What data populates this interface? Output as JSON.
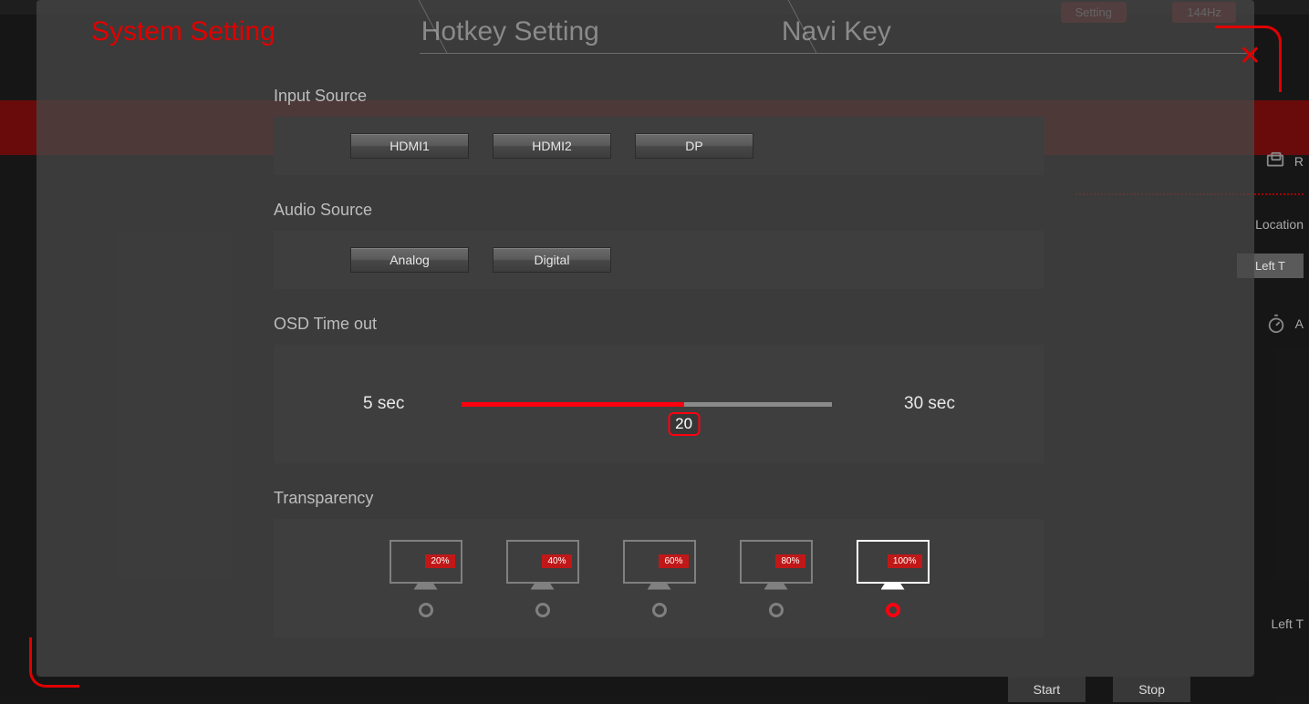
{
  "background": {
    "setting_pill": "Setting",
    "hz_pill": "144Hz",
    "r_label": "R",
    "location_label": "Location",
    "left_top_btn": "Left T",
    "a_label": "A",
    "left_t_label": "Left T",
    "start_btn": "Start",
    "stop_btn": "Stop"
  },
  "tabs": {
    "system": "System Setting",
    "hotkey": "Hotkey Setting",
    "navi": "Navi Key"
  },
  "input_source": {
    "label": "Input Source",
    "options": [
      "HDMI1",
      "HDMI2",
      "DP"
    ]
  },
  "audio_source": {
    "label": "Audio Source",
    "options": [
      "Analog",
      "Digital"
    ]
  },
  "osd": {
    "label": "OSD Time out",
    "min_label": "5 sec",
    "max_label": "30 sec",
    "min": 5,
    "max": 30,
    "value": 20,
    "value_label": "20"
  },
  "transparency": {
    "label": "Transparency",
    "options": [
      "20%",
      "40%",
      "60%",
      "80%",
      "100%"
    ],
    "selected": 4
  }
}
